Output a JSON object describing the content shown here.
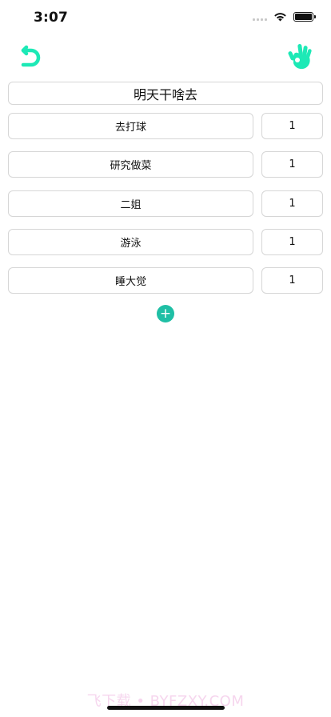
{
  "status_bar": {
    "time": "3:07"
  },
  "toolbar": {
    "back_icon": "undo-arrow-icon",
    "confirm_icon": "ok-hand-icon",
    "accent_color": "#1de9b6"
  },
  "title": "明天干啥去",
  "options": [
    {
      "name": "去打球",
      "weight": "1"
    },
    {
      "name": "研究做菜",
      "weight": "1"
    },
    {
      "name": "二姐",
      "weight": "1"
    },
    {
      "name": "游泳",
      "weight": "1"
    },
    {
      "name": "睡大觉",
      "weight": "1"
    }
  ],
  "add_button": {
    "label": "+",
    "color": "#1fbfa5"
  },
  "watermark": "飞下载 • BYFZXY.COM"
}
